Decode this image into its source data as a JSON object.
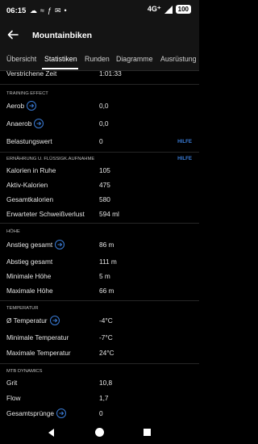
{
  "status_bar": {
    "time": "06:15",
    "network": "4G⁺",
    "battery": "100"
  },
  "app_bar": {
    "title": "Mountainbiken"
  },
  "tabs": [
    {
      "label": "Übersicht"
    },
    {
      "label": "Statistiken",
      "active": true
    },
    {
      "label": "Runden"
    },
    {
      "label": "Diagramme"
    },
    {
      "label": "Ausrüstung"
    }
  ],
  "top_row": {
    "label": "Verstrichene Zeit",
    "value": "1:01:33"
  },
  "training_effect": {
    "header": "TRAINING EFFECT",
    "rows": [
      {
        "label": "Aerob",
        "value": "0,0",
        "info": true
      },
      {
        "label": "Anaerob",
        "value": "0,0",
        "info": true
      },
      {
        "label": "Belastungswert",
        "value": "0",
        "help": "HILFE"
      }
    ]
  },
  "nutrition": {
    "header": "ERNÄHRUNG U. FLÜSSIGK.AUFNAHME",
    "help": "HILFE",
    "rows": [
      {
        "label": "Kalorien in Ruhe",
        "value": "105"
      },
      {
        "label": "Aktiv-Kalorien",
        "value": "475"
      },
      {
        "label": "Gesamtkalorien",
        "value": "580"
      },
      {
        "label": "Erwarteter Schweißverlust",
        "value": "594 ml"
      }
    ]
  },
  "elevation": {
    "header": "HÖHE",
    "rows": [
      {
        "label": "Anstieg gesamt",
        "value": "86 m",
        "info": true
      },
      {
        "label": "Abstieg gesamt",
        "value": "111 m"
      },
      {
        "label": "Minimale Höhe",
        "value": "5 m"
      },
      {
        "label": "Maximale Höhe",
        "value": "66 m"
      }
    ]
  },
  "temperature": {
    "header": "TEMPERATUR",
    "rows": [
      {
        "label": "Ø Temperatur",
        "value": "-4°C",
        "info": true
      },
      {
        "label": "Minimale Temperatur",
        "value": "-7°C"
      },
      {
        "label": "Maximale Temperatur",
        "value": "24°C"
      }
    ]
  },
  "mtb_dynamics": {
    "header": "MTB DYNAMICS",
    "rows": [
      {
        "label": "Grit",
        "value": "10,8"
      },
      {
        "label": "Flow",
        "value": "1,7"
      },
      {
        "label": "Gesamtsprünge",
        "value": "0",
        "info": true
      }
    ]
  },
  "colors": {
    "accent": "#3a7bd5",
    "background": "#000000",
    "bar": "#141414"
  }
}
